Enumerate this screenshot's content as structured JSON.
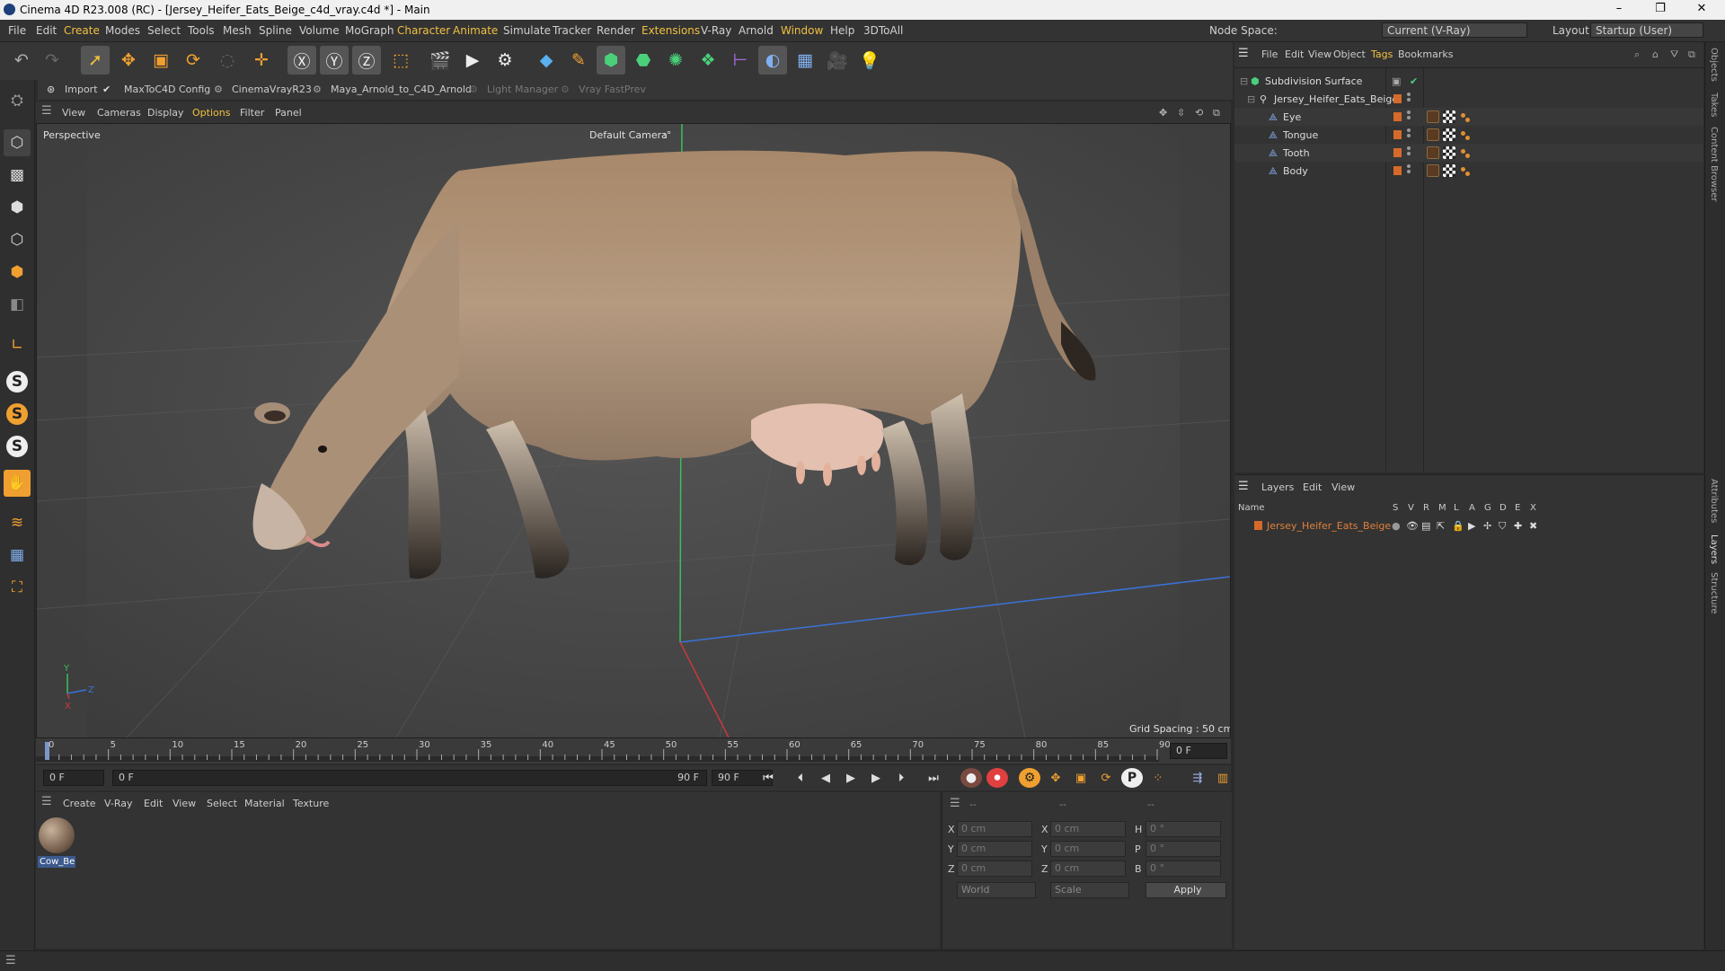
{
  "window": {
    "title": "Cinema 4D R23.008 (RC) - [Jersey_Heifer_Eats_Beige_c4d_vray.c4d *] - Main",
    "minimize": "–",
    "maximize": "❐",
    "close": "✕"
  },
  "menubar": {
    "items": [
      "File",
      "Edit",
      "Create",
      "Modes",
      "Select",
      "Tools",
      "Mesh",
      "Spline",
      "Volume",
      "MoGraph",
      "Character",
      "Animate",
      "Simulate",
      "Tracker",
      "Render",
      "Extensions",
      "V-Ray",
      "Arnold",
      "Window",
      "Help",
      "3DToAll"
    ],
    "node_space_label": "Node Space:",
    "node_space_value": "Current (V-Ray)",
    "layout_label": "Layout:",
    "layout_value": "Startup (User)"
  },
  "plugin_bar": {
    "items": [
      "Import",
      "MaxToC4D Config",
      "CinemaVrayR23",
      "Maya_Arnold_to_C4D_Arnold",
      "Light Manager",
      "Vray FastPrev"
    ]
  },
  "viewport": {
    "menu": [
      "View",
      "Cameras",
      "Display",
      "Options",
      "Filter",
      "Panel"
    ],
    "view_name": "Perspective",
    "camera": "Default Camera",
    "camera_suffix": ":°",
    "grid_spacing": "Grid Spacing : 50 cm",
    "axis_y": "Y",
    "axis_z": "Z",
    "axis_x": "X"
  },
  "timeline": {
    "ticks": [
      "0",
      "5",
      "10",
      "15",
      "20",
      "25",
      "30",
      "35",
      "40",
      "45",
      "50",
      "55",
      "60",
      "65",
      "70",
      "75",
      "80",
      "85",
      "90"
    ],
    "current_frame": "0 F"
  },
  "transport": {
    "start_field": "0 F",
    "range_start": "0 F",
    "range_end": "90 F",
    "end_field": "90 F"
  },
  "material_manager": {
    "menu": [
      "Create",
      "V-Ray",
      "Edit",
      "View",
      "Select",
      "Material",
      "Texture"
    ],
    "materials": [
      {
        "name": "Cow_Be"
      }
    ]
  },
  "coordinates": {
    "header": [
      "--",
      "--",
      "--"
    ],
    "rows": [
      {
        "a": "X",
        "av": "0 cm",
        "b": "X",
        "bv": "0 cm",
        "c": "H",
        "cv": "0 °"
      },
      {
        "a": "Y",
        "av": "0 cm",
        "b": "Y",
        "bv": "0 cm",
        "c": "P",
        "cv": "0 °"
      },
      {
        "a": "Z",
        "av": "0 cm",
        "b": "Z",
        "bv": "0 cm",
        "c": "B",
        "cv": "0 °"
      }
    ],
    "world": "World",
    "scale": "Scale",
    "apply": "Apply"
  },
  "object_manager": {
    "menu": [
      "File",
      "Edit",
      "View",
      "Object",
      "Tags",
      "Bookmarks"
    ],
    "objects": [
      {
        "name": "Subdivision Surface"
      },
      {
        "name": "Jersey_Heifer_Eats_Beige"
      },
      {
        "name": "Eye"
      },
      {
        "name": "Tongue"
      },
      {
        "name": "Tooth"
      },
      {
        "name": "Body"
      }
    ]
  },
  "layer_manager": {
    "menu": [
      "Layers",
      "Edit",
      "View"
    ],
    "columns": [
      "Name",
      "S",
      "V",
      "R",
      "M",
      "L",
      "A",
      "G",
      "D",
      "E",
      "X"
    ],
    "layers": [
      {
        "name": "Jersey_Heifer_Eats_Beige"
      }
    ]
  },
  "side_tabs": [
    "Objects",
    "Takes",
    "Content Browser",
    "Attributes",
    "Layers",
    "Structure"
  ],
  "colors": {
    "accent": "#f0c040",
    "layer_text": "#e0803a",
    "swatch": "#d66a2a"
  }
}
